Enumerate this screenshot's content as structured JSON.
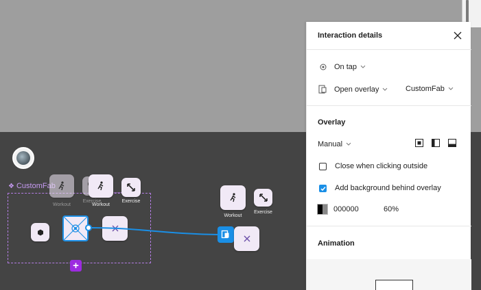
{
  "canvas": {
    "component_label": "CustomFab",
    "chips": [
      {
        "name": "workout",
        "label": "Workout",
        "icon": "run-icon"
      },
      {
        "name": "exercise",
        "label": "Exercise",
        "icon": "expand-icon"
      }
    ],
    "main_fab_icon": "cross-circle-icon",
    "close_icon": "close-icon"
  },
  "panel": {
    "title": "Interaction details",
    "trigger": {
      "label": "On tap",
      "icon": "tap-icon"
    },
    "action": {
      "label": "Open overlay",
      "icon": "overlay-icon"
    },
    "destination": {
      "label": "CustomFab"
    },
    "overlay": {
      "title": "Overlay",
      "position": "Manual",
      "options": {
        "close_outside": {
          "label": "Close when clicking outside",
          "checked": false
        },
        "add_background": {
          "label": "Add background behind overlay",
          "checked": true
        }
      },
      "bg_color": "000000",
      "bg_opacity": "60%"
    },
    "animation_title": "Animation"
  },
  "colors": {
    "accent": "#1a8fe6",
    "component": "#9d2be0",
    "chip_bg": "#f1e9f6"
  }
}
